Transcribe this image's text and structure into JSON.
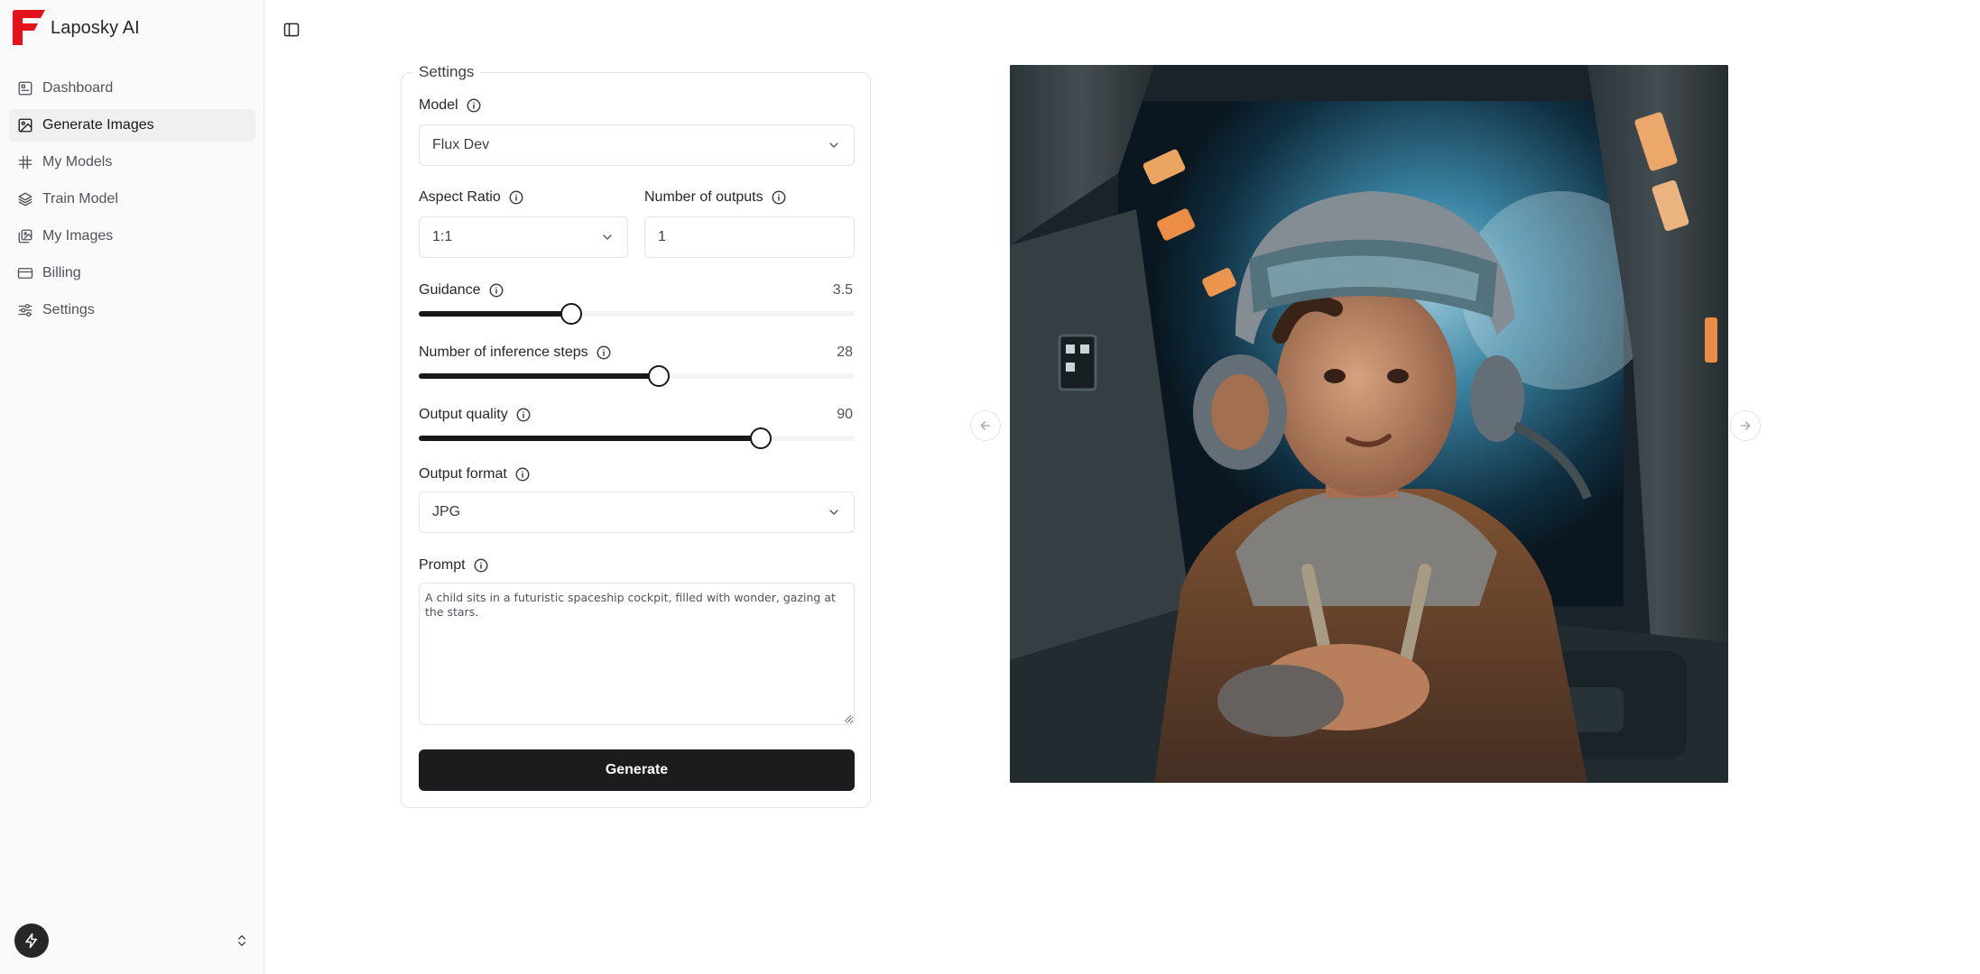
{
  "app": {
    "name": "Laposky AI"
  },
  "sidebar": {
    "items": [
      {
        "label": "Dashboard",
        "icon": "dashboard-icon",
        "active": false
      },
      {
        "label": "Generate Images",
        "icon": "image-icon",
        "active": true
      },
      {
        "label": "My Models",
        "icon": "hash-icon",
        "active": false
      },
      {
        "label": "Train Model",
        "icon": "layers-icon",
        "active": false
      },
      {
        "label": "My Images",
        "icon": "images-icon",
        "active": false
      },
      {
        "label": "Billing",
        "icon": "credit-card-icon",
        "active": false
      },
      {
        "label": "Settings",
        "icon": "sliders-icon",
        "active": false
      }
    ]
  },
  "settings": {
    "legend": "Settings",
    "model": {
      "label": "Model",
      "value": "Flux Dev"
    },
    "aspect_ratio": {
      "label": "Aspect Ratio",
      "value": "1:1"
    },
    "num_outputs": {
      "label": "Number of outputs",
      "value": "1"
    },
    "guidance": {
      "label": "Guidance",
      "value": "3.5",
      "fraction": 0.35
    },
    "inference_steps": {
      "label": "Number of inference steps",
      "value": "28",
      "fraction": 0.55
    },
    "output_quality": {
      "label": "Output quality",
      "value": "90",
      "fraction": 0.785
    },
    "output_format": {
      "label": "Output format",
      "value": "JPG"
    },
    "prompt": {
      "label": "Prompt",
      "value": "A child sits in a futuristic spaceship cockpit, filled with wonder, gazing at the stars."
    },
    "generate_label": "Generate"
  },
  "preview": {
    "image_description_icon": "generated-image"
  },
  "colors": {
    "accent": "#18181b",
    "logo_red": "#e5121b",
    "sidebar_bg": "#fafafa"
  }
}
